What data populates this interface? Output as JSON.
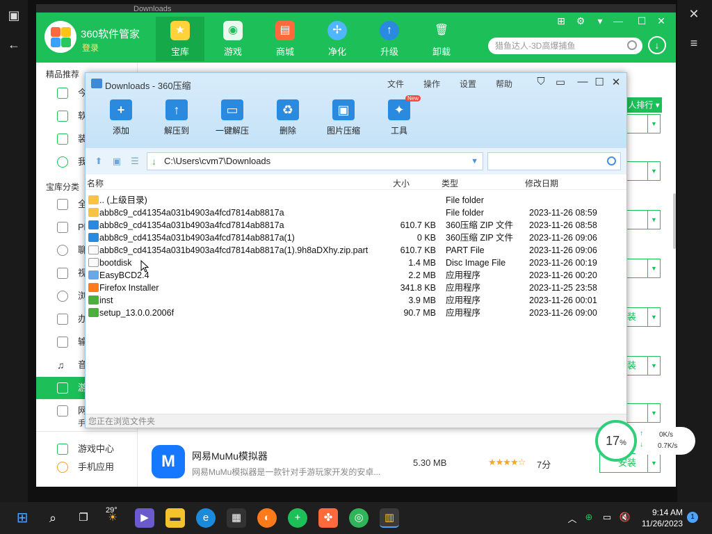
{
  "background_window": {
    "title": "Downloads"
  },
  "main360": {
    "brand": "360软件管家",
    "login": "登录",
    "nav": [
      {
        "label": "宝库",
        "icon": "star-icon"
      },
      {
        "label": "游戏",
        "icon": "gamepad-icon"
      },
      {
        "label": "商城",
        "icon": "bag-icon"
      },
      {
        "label": "净化",
        "icon": "fan-icon"
      },
      {
        "label": "升级",
        "icon": "upgrade-icon"
      },
      {
        "label": "卸载",
        "icon": "trash-icon"
      }
    ],
    "search_placeholder": "猎鱼达人-3D高爆捕鱼",
    "sidebar": {
      "section1": "精品推荐",
      "items1": [
        {
          "label": "今"
        },
        {
          "label": "软"
        },
        {
          "label": "装"
        },
        {
          "label": "我"
        }
      ],
      "section2": "宝库分类",
      "items2": [
        {
          "label": "全"
        },
        {
          "label": "Pl"
        },
        {
          "label": "聊"
        },
        {
          "label": "视"
        },
        {
          "label": "浏"
        },
        {
          "label": "办"
        },
        {
          "label": "输"
        },
        {
          "label": "音"
        },
        {
          "label": "游"
        },
        {
          "label": "网"
        },
        {
          "label": "手游电脑版"
        }
      ],
      "bottom": [
        {
          "label": "游戏中心"
        },
        {
          "label": "手机应用"
        }
      ]
    },
    "rank_label": "人排行",
    "install_label": "安装",
    "install_partial": "装",
    "app_row": {
      "icon_letter": "M",
      "name": "网易MuMu模拟器",
      "desc": "网易MuMu模拟器是一款针对手游玩家开发的安卓...",
      "size": "5.30 MB",
      "stars": "★★★★☆",
      "rating": "7分"
    }
  },
  "zip": {
    "title": "Downloads - 360压缩",
    "menu": [
      "文件",
      "操作",
      "设置",
      "帮助"
    ],
    "tools": [
      {
        "label": "添加",
        "glyph": "+"
      },
      {
        "label": "解压到",
        "glyph": "↑"
      },
      {
        "label": "一键解压",
        "glyph": "▭"
      },
      {
        "label": "删除",
        "glyph": "♻"
      },
      {
        "label": "图片压缩",
        "glyph": "▣"
      },
      {
        "label": "工具",
        "glyph": "✦",
        "badge": "New"
      }
    ],
    "path": "C:\\Users\\cvm7\\Downloads",
    "columns": {
      "name": "名称",
      "size": "大小",
      "type": "类型",
      "date": "修改日期"
    },
    "files": [
      {
        "name": ".. (上级目录)",
        "size": "",
        "type": "File folder",
        "date": "",
        "icon": "folder"
      },
      {
        "name": "abb8c9_cd41354a031b4903a4fcd7814ab8817a",
        "size": "",
        "type": "File folder",
        "date": "2023-11-26 08:59",
        "icon": "folder"
      },
      {
        "name": "abb8c9_cd41354a031b4903a4fcd7814ab8817a",
        "size": "610.7 KB",
        "type": "360压缩 ZIP 文件",
        "date": "2023-11-26 08:58",
        "icon": "zip"
      },
      {
        "name": "abb8c9_cd41354a031b4903a4fcd7814ab8817a(1)",
        "size": "0 KB",
        "type": "360压缩 ZIP 文件",
        "date": "2023-11-26 09:06",
        "icon": "zip"
      },
      {
        "name": "abb8c9_cd41354a031b4903a4fcd7814ab8817a(1).9h8aDXhy.zip.part",
        "size": "610.7 KB",
        "type": "PART File",
        "date": "2023-11-26 09:06",
        "icon": "blank"
      },
      {
        "name": "bootdisk",
        "size": "1.4 MB",
        "type": "Disc Image File",
        "date": "2023-11-26 00:19",
        "icon": "blank"
      },
      {
        "name": "EasyBCD2.4",
        "size": "2.2 MB",
        "type": "应用程序",
        "date": "2023-11-26 00:20",
        "icon": "app"
      },
      {
        "name": "Firefox Installer",
        "size": "341.8 KB",
        "type": "应用程序",
        "date": "2023-11-25 23:58",
        "icon": "firefox"
      },
      {
        "name": "inst",
        "size": "3.9 MB",
        "type": "应用程序",
        "date": "2023-11-26 00:01",
        "icon": "green"
      },
      {
        "name": "setup_13.0.0.2006f",
        "size": "90.7 MB",
        "type": "应用程序",
        "date": "2023-11-26 09:00",
        "icon": "green"
      }
    ],
    "status": "您正在浏览文件夹"
  },
  "net": {
    "percent": "17",
    "unit": "%",
    "up": "0K/s",
    "down": "0.7K/s"
  },
  "taskbar": {
    "weather": "29°",
    "time": "9:14 AM",
    "date": "11/26/2023",
    "notif": "1"
  },
  "colors": {
    "green": "#1dbf58",
    "blue": "#2a8ae0"
  }
}
